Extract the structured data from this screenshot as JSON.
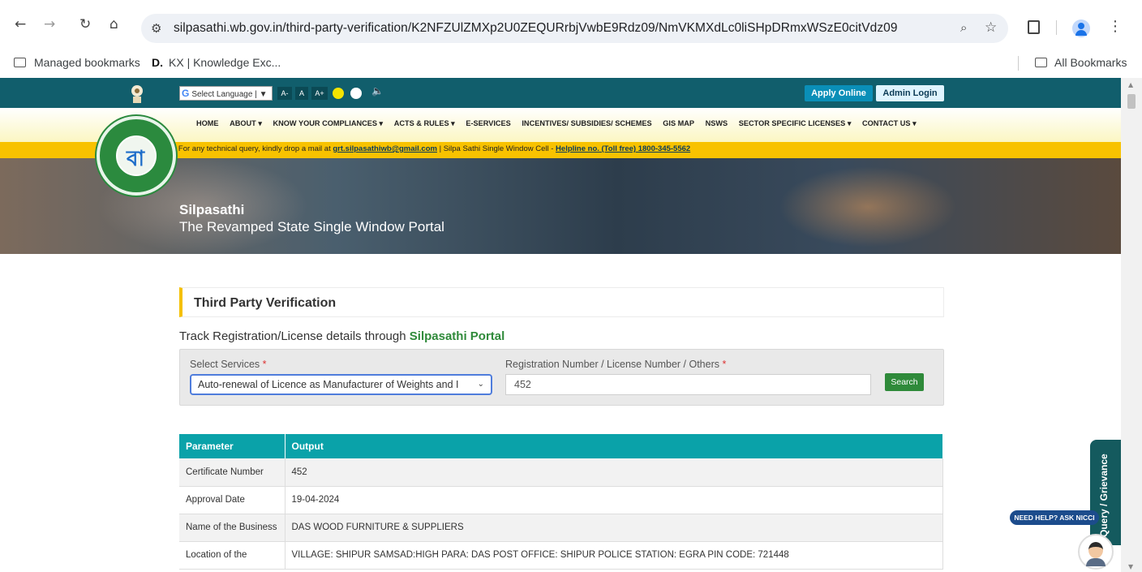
{
  "browser": {
    "url": "silpasathi.wb.gov.in/third-party-verification/K2NFZUlZMXp2U0ZEQURrbjVwbE9Rdz09/NmVKMXdLc0liSHpDRmxWSzE0citVdz09",
    "bookmarks": [
      "Managed bookmarks",
      "KX | Knowledge Exc..."
    ],
    "bookmark_d": "D.",
    "all_bookmarks": "All Bookmarks"
  },
  "topbar": {
    "translate_label": "Select Language",
    "translate_arrow": "▼",
    "font_small": "A-",
    "font_normal": "A",
    "font_large": "A+",
    "apply_online": "Apply Online",
    "admin_login": "Admin Login"
  },
  "menu": [
    "HOME",
    "ABOUT ▾",
    "KNOW YOUR COMPLIANCES ▾",
    "ACTS & RULES ▾",
    "E-SERVICES",
    "INCENTIVES/ SUBSIDIES/ SCHEMES",
    "GIS MAP",
    "NSWS",
    "SECTOR SPECIFIC LICENSES ▾",
    "CONTACT US ▾"
  ],
  "ticker": {
    "prefix": "g For any technical query, kindly drop a mail at ",
    "email": "grt.silpasathiwb@gmail.com",
    "divider": "   |   Silpa Sathi Single Window Cell - ",
    "helpline": "Helpline no. (Toll free) 1800-345-5562"
  },
  "banner": {
    "title": "Silpasathi",
    "subtitle": "The Revamped State Single Window Portal"
  },
  "page": {
    "section_title": "Third Party Verification",
    "track_prefix": "Track Registration/License details through ",
    "track_accent": "Silpasathi Portal"
  },
  "form": {
    "service_label": "Select Services",
    "service_value": "Auto-renewal of Licence as Manufacturer of Weights and I",
    "reg_label": "Registration Number / License Number / Others",
    "reg_value": "452",
    "required_mark": "*",
    "search_label": "Search"
  },
  "results": {
    "headers": [
      "Parameter",
      "Output"
    ],
    "rows": [
      {
        "param": "Certificate Number",
        "value": "452"
      },
      {
        "param": "Approval Date",
        "value": "19-04-2024"
      },
      {
        "param": "Name of the Business",
        "value": "DAS WOOD FURNITURE & SUPPLIERS"
      },
      {
        "param": "Location of the",
        "value": "VILLAGE: SHIPUR SAMSAD:HIGH PARA: DAS POST OFFICE: SHIPUR POLICE STATION: EGRA PIN CODE: 721448"
      }
    ]
  },
  "widgets": {
    "grievance": "Query / Grievance",
    "nicci": "NEED HELP? ASK NICCI"
  },
  "colors": {
    "topbar": "#115e6c",
    "ticker": "#f8c200",
    "table_header": "#0aa2a9",
    "accent_green": "#2f8a3a",
    "apply_button": "#0a8fb8"
  }
}
